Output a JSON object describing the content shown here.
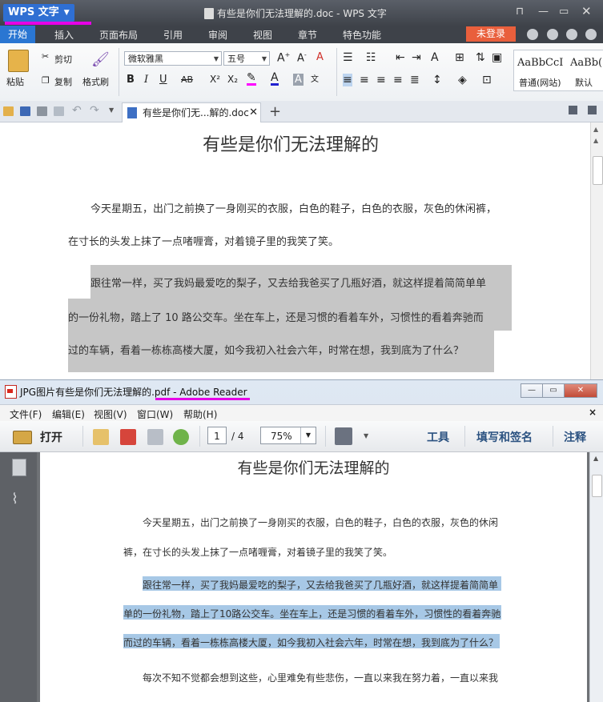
{
  "wps": {
    "app_name": "WPS 文字",
    "window_title": "有些是你们无法理解的.doc - WPS 文字",
    "menu_tabs": [
      "开始",
      "插入",
      "页面布局",
      "引用",
      "审阅",
      "视图",
      "章节",
      "特色功能"
    ],
    "login_label": "未登录",
    "ribbon": {
      "paste_label": "粘贴",
      "cut_label": "剪切",
      "copy_label": "复制",
      "format_painter_label": "格式刷",
      "font_name": "微软雅黑",
      "font_size": "五号",
      "bold": "B",
      "italic": "I",
      "underline": "U",
      "strike": "AB",
      "superscript": "X²",
      "subscript": "X₂",
      "style_sample_1": "AaBbCcI",
      "style_sample_2": "AaBb(",
      "style_name_1": "普通(网站)",
      "style_name_2": "默认"
    },
    "doc_tab_label": "有些是你们无...解的.doc",
    "document": {
      "title": "有些是你们无法理解的",
      "lines": [
        "今天星期五，出门之前换了一身刚买的衣服，白色的鞋子，白色的衣服，灰色的休闲裤，",
        "在寸长的头发上抹了一点啫喱膏，对着镜子里的我笑了笑。",
        "跟往常一样，买了我妈最爱吃的梨子，又去给我爸买了几瓶好酒，就这样提着简简单单",
        "的一份礼物，踏上了 10 路公交车。坐在车上，还是习惯的看着车外，习惯性的看着奔驰而",
        "过的车辆，看着一栋栋高楼大厦，如今我初入社会六年，时常在想，我到底为了什么？"
      ]
    }
  },
  "reader": {
    "window_title": "JPG图片有些是你们无法理解的.pdf - Adobe Reader",
    "menu_items": [
      "文件(F)",
      "编辑(E)",
      "视图(V)",
      "窗口(W)",
      "帮助(H)"
    ],
    "menu_close": "×",
    "open_label": "打开",
    "current_page": "1",
    "total_pages": "/ 4",
    "zoom": "75%",
    "tool_labels": [
      "工具",
      "填写和签名",
      "注释"
    ],
    "document": {
      "title": "有些是你们无法理解的",
      "lines": [
        "今天星期五，出门之前换了一身刚买的衣服，白色的鞋子，白色的衣服，灰色的休闲",
        "裤，在寸长的头发上抹了一点啫喱膏，对着镜子里的我笑了笑。",
        "跟往常一样，买了我妈最爱吃的梨子，又去给我爸买了几瓶好酒，就这样提着简简单",
        "单的一份礼物，踏上了10路公交车。坐在车上，还是习惯的看着车外，习惯性的看着奔驰",
        "而过的车辆，看着一栋栋高楼大厦，如今我初入社会六年，时常在想，我到底为了什么？",
        "每次不知不觉都会想到这些，心里难免有些悲伤，一直以来我在努力着，一直以来我"
      ]
    }
  },
  "colors": {
    "annotation_underline": "#e600e6",
    "wps_accent": "#2a76d2",
    "login_button": "#e95f3c",
    "wps_selection": "#c6c6c6",
    "reader_selection": "#a7c8e6"
  }
}
